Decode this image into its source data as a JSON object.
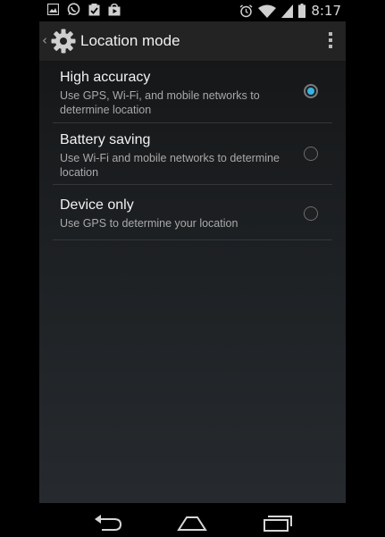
{
  "status_bar": {
    "time": "8:17",
    "notification_icons": [
      "gallery-icon",
      "whatsapp-icon",
      "clipboard-check-icon",
      "shopping-bag-icon"
    ],
    "system_icons": [
      "alarm-icon",
      "wifi-icon",
      "signal-icon",
      "battery-icon"
    ]
  },
  "action_bar": {
    "title": "Location mode",
    "icon": "settings-gear-icon",
    "overflow_icon": "overflow-menu-icon"
  },
  "options": [
    {
      "label": "High accuracy",
      "description": "Use GPS, Wi-Fi, and mobile networks to determine location",
      "selected": true
    },
    {
      "label": "Battery saving",
      "description": "Use Wi-Fi and mobile networks to determine location",
      "selected": false
    },
    {
      "label": "Device only",
      "description": "Use GPS to determine your location",
      "selected": false
    }
  ],
  "nav_bar": {
    "buttons": [
      "back-icon",
      "home-icon",
      "recents-icon"
    ]
  },
  "colors": {
    "accent": "#33b5e5",
    "action_bar": "#232323"
  }
}
